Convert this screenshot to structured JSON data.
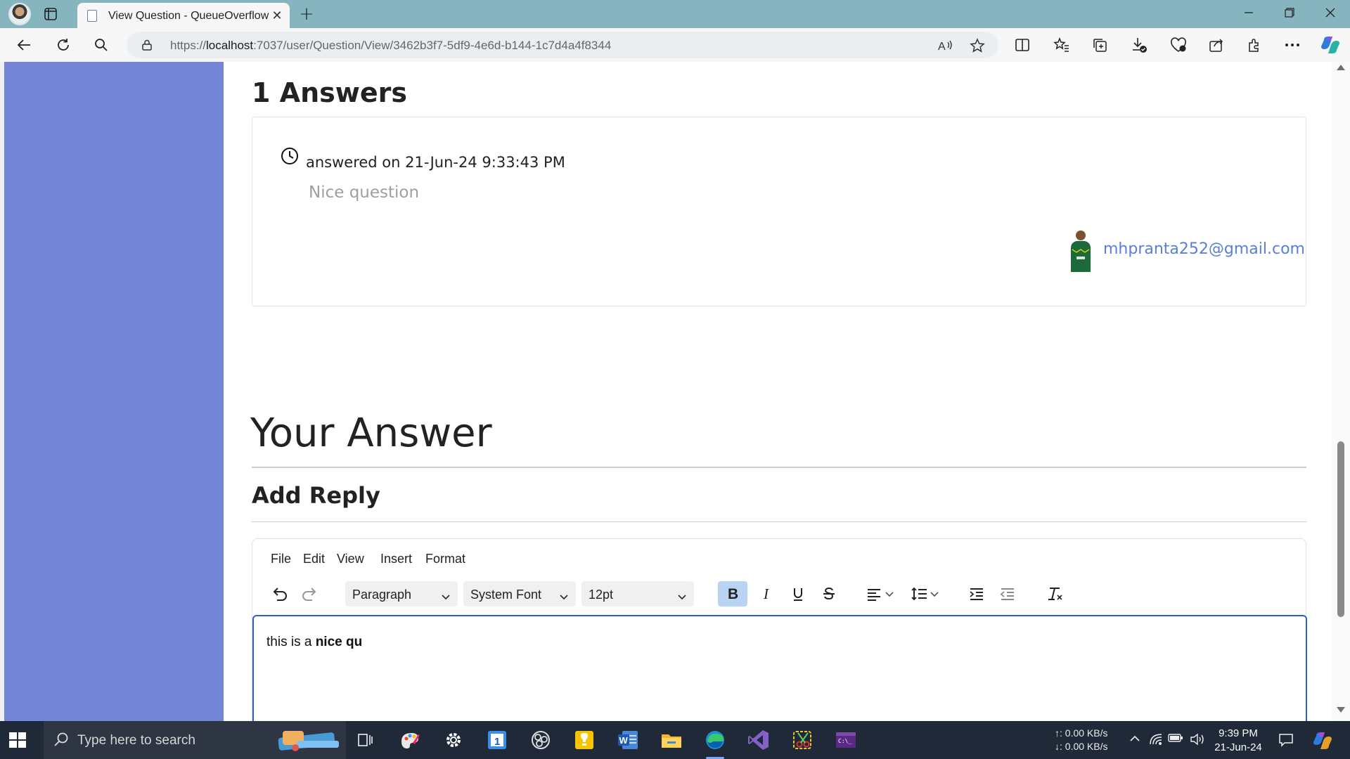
{
  "browser": {
    "tab_title": "View Question - QueueOverflow",
    "url_prefix": "https://",
    "url_host": "localhost",
    "url_rest": ":7037/user/Question/View/3462b3f7-5df9-4e6d-b144-1c7d4a4f8344",
    "accent_color": "#86b4bf"
  },
  "page": {
    "answers_heading": "1 Answers",
    "answer": {
      "meta": "answered on 21-Jun-24 9:33:43 PM",
      "body": "Nice question",
      "author_email": "mhpranta252@gmail.com"
    },
    "your_answer_heading": "Your Answer",
    "add_reply_heading": "Add Reply",
    "sidebar_color": "#7586d6"
  },
  "editor": {
    "menu": [
      "File",
      "Edit",
      "View",
      "Insert",
      "Format"
    ],
    "block_format": "Paragraph",
    "font_family": "System Font",
    "font_size": "12pt",
    "content_plain": "this is a ",
    "content_bold": "nice qu"
  },
  "taskbar": {
    "search_placeholder": "Type here to search",
    "net_up": "↑: 0.00 KB/s",
    "net_down": "↓: 0.00 KB/s",
    "time": "9:39 PM",
    "date": "21-Jun-24"
  }
}
